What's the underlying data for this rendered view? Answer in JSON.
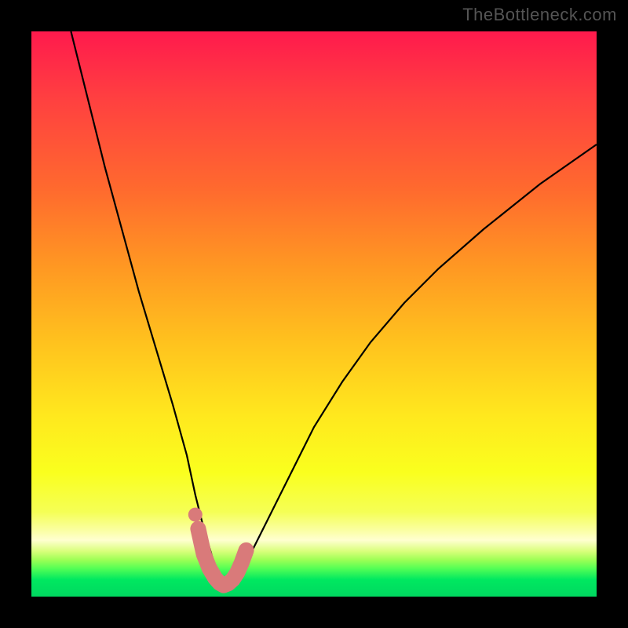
{
  "watermark": "TheBottleneck.com",
  "chart_data": {
    "type": "line",
    "title": "",
    "xlabel": "",
    "ylabel": "",
    "xlim": [
      0,
      100
    ],
    "ylim": [
      0,
      100
    ],
    "series": [
      {
        "name": "bottleneck-curve",
        "x": [
          7,
          10,
          13,
          16,
          19,
          22,
          25,
          27.5,
          29,
          30.5,
          32,
          33,
          34,
          35,
          36,
          37,
          39,
          42,
          46,
          50,
          55,
          60,
          66,
          72,
          80,
          90,
          100
        ],
        "values": [
          100,
          88,
          76,
          65,
          54,
          44,
          34,
          25,
          18,
          12,
          7,
          4,
          2,
          1.5,
          2,
          4,
          8,
          14,
          22,
          30,
          38,
          45,
          52,
          58,
          65,
          73,
          80
        ]
      }
    ],
    "highlight": {
      "name": "optimal-zone",
      "color": "#d97a7a",
      "x": [
        29.5,
        30.5,
        31.5,
        32.5,
        33.3,
        34.0,
        34.8,
        35.6,
        36.4,
        37.2,
        38.0
      ],
      "values": [
        12.0,
        7.5,
        5.0,
        3.3,
        2.4,
        2.0,
        2.3,
        3.0,
        4.2,
        6.0,
        8.2
      ]
    },
    "highlight_dot": {
      "x": 29.0,
      "value": 14.5,
      "color": "#d97a7a"
    }
  }
}
